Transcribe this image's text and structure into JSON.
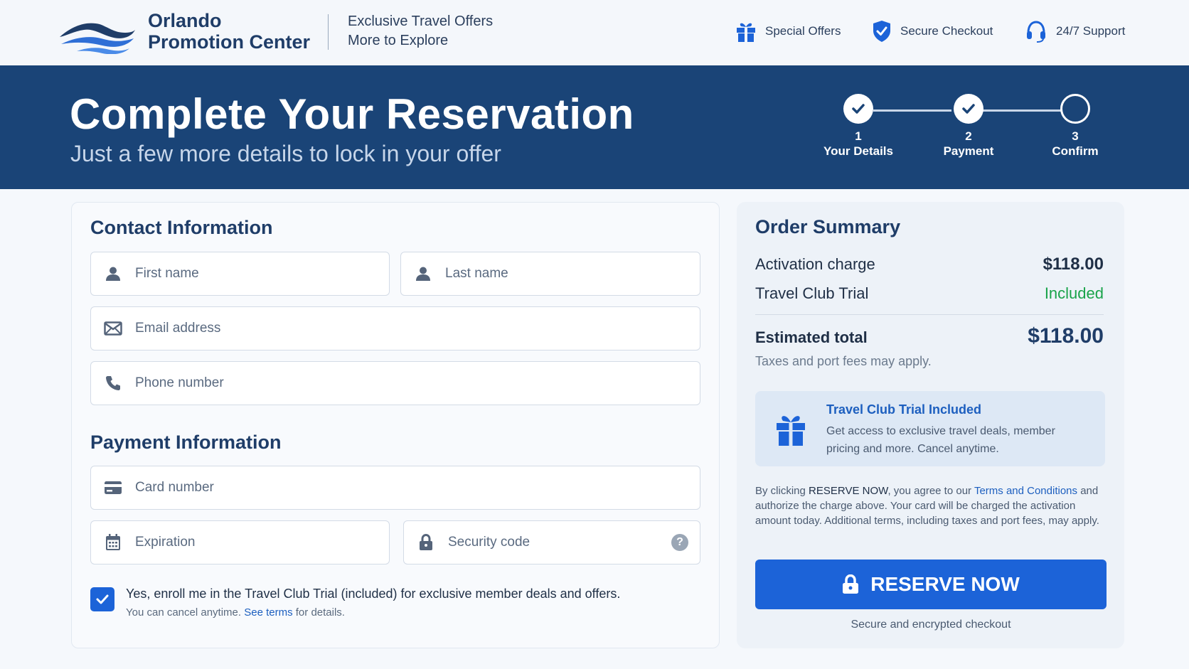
{
  "header": {
    "brand_line1": "Orlando",
    "brand_line2": "Promotion Center",
    "tagline_line1": "Exclusive Travel Offers",
    "tagline_line2": "More to Explore",
    "nav": [
      {
        "label": "Special Offers",
        "icon": "gift-icon"
      },
      {
        "label": "Secure Checkout",
        "icon": "shield-check-icon"
      },
      {
        "label": "24/7 Support",
        "icon": "headset-icon"
      }
    ]
  },
  "banner": {
    "title": "Complete Your Reservation",
    "subtitle": "Just a few more details to lock in your offer",
    "steps": [
      {
        "number": "1",
        "label": "Your Details",
        "status": "complete"
      },
      {
        "number": "2",
        "label": "Payment",
        "status": "complete"
      },
      {
        "number": "3",
        "label": "Confirm",
        "status": "pending"
      }
    ]
  },
  "contact": {
    "title": "Contact Information",
    "first_name_placeholder": "First name",
    "last_name_placeholder": "Last name",
    "email_placeholder": "Email address",
    "phone_placeholder": "Phone number"
  },
  "payment": {
    "title": "Payment Information",
    "card_placeholder": "Card number",
    "expiration_placeholder": "Expiration",
    "security_placeholder": "Security code",
    "help_glyph": "?"
  },
  "consent": {
    "checked": true,
    "main_text": "Yes, enroll me in the Travel Club Trial (included) for exclusive member deals and offers.",
    "sub_prefix": "You can cancel anytime.",
    "sub_link": "See terms",
    "sub_suffix": "for details."
  },
  "summary": {
    "title": "Order Summary",
    "activation_label": "Activation charge",
    "activation_value": "$118.00",
    "trial_label": "Travel Club Trial",
    "trial_value": "Included",
    "total_label": "Estimated total",
    "total_value": "$118.00",
    "tax_note": "Taxes and port fees may apply.",
    "trial_box_title": "Travel Club Trial Included",
    "trial_box_desc": "Get access to exclusive travel deals, member pricing and more. Cancel anytime.",
    "legal_prefix": "By clicking",
    "legal_button_ref": "RESERVE NOW",
    "legal_mid": ", you agree to our",
    "legal_link": "Terms and Conditions",
    "legal_suffix": "and authorize the charge above. Your card will be charged the activation amount today. Additional terms, including taxes and port fees, may apply.",
    "reserve_label": "RESERVE NOW",
    "secure_note": "Secure and encrypted checkout"
  },
  "colors": {
    "banner_bg": "#1a4477",
    "primary_button": "#1c63d8",
    "brand_text": "#1f3d68",
    "included_green": "#19a34a",
    "link": "#1d5fbf"
  }
}
